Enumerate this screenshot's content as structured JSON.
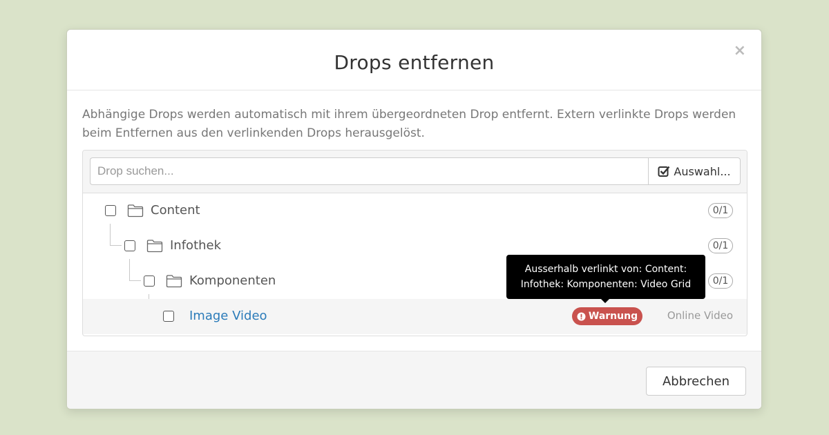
{
  "modal": {
    "title": "Drops entfernen",
    "close_label": "×",
    "description": "Abhängige Drops werden automatisch mit ihrem übergeordneten Drop entfernt. Extern verlinkte Drops werden beim Entfernen aus den verlinkenden Drops herausgelöst."
  },
  "search": {
    "placeholder": "Drop suchen...",
    "value": "",
    "select_label": "Auswahl..."
  },
  "tree": {
    "items": [
      {
        "label": "Content",
        "count": "0/1"
      },
      {
        "label": "Infothek",
        "count": "0/1"
      },
      {
        "label": "Komponenten",
        "count": "0/1"
      },
      {
        "label": "Image Video",
        "warning": "Warnung",
        "type": "Online Video"
      }
    ]
  },
  "tooltip": {
    "line1": "Ausserhalb verlinkt von: Content:",
    "line2": "Infothek: Komponenten: Video Grid"
  },
  "footer": {
    "cancel_label": "Abbrechen"
  },
  "colors": {
    "background": "#dae3c9",
    "link": "#2b7bb9",
    "warning": "#c9524e"
  },
  "icons": [
    "close-icon",
    "check-square-icon",
    "checkbox-icon",
    "folder-icon",
    "exclamation-circle-icon"
  ]
}
